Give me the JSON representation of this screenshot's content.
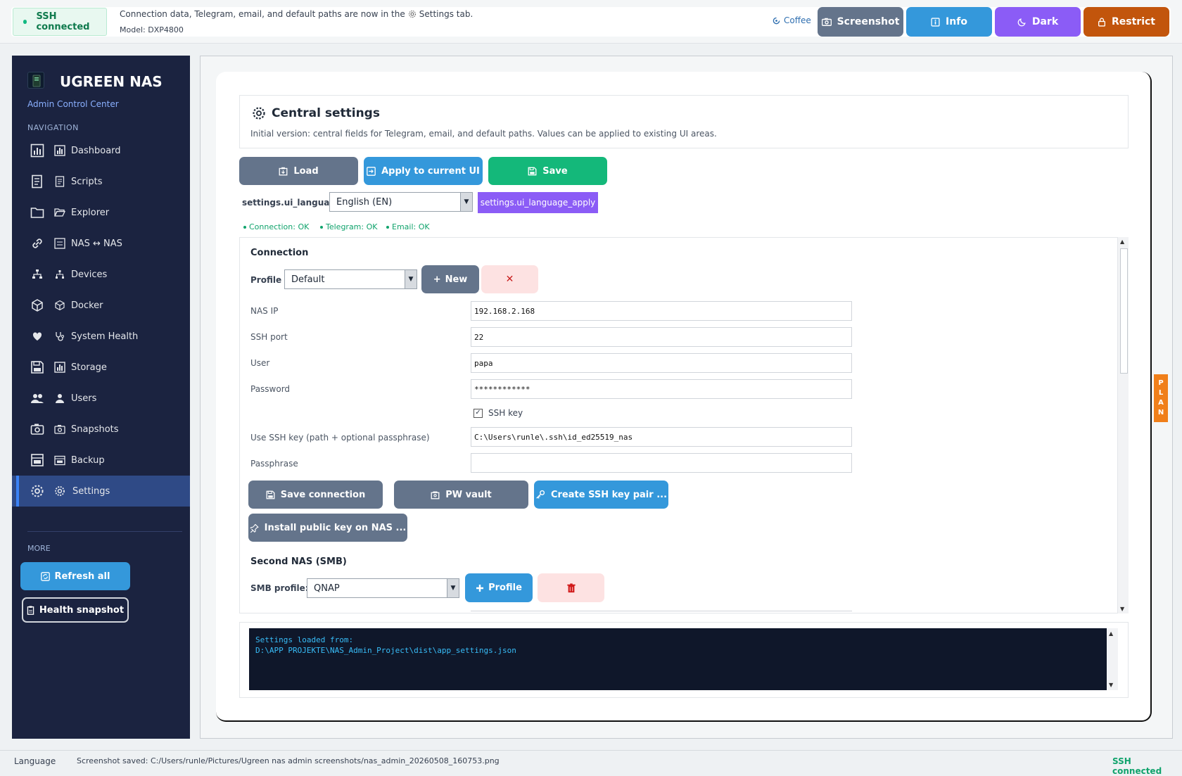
{
  "topbar": {
    "ssh_status": "SSH connected",
    "info_line_prefix": "Connection data, Telegram, email, and default paths are now in the",
    "info_line_suffix": "Settings tab.",
    "model": "Model: DXP4800",
    "coffee": "Coffee",
    "buttons": {
      "screenshot": "Screenshot",
      "info": "Info",
      "dark": "Dark",
      "restrict": "Restrict"
    }
  },
  "sidebar": {
    "title": "UGREEN NAS",
    "subtitle": "Admin Control Center",
    "nav_heading": "NAVIGATION",
    "items": [
      {
        "label": "Dashboard",
        "icon": "bar-chart-icon"
      },
      {
        "label": "Scripts",
        "icon": "script-icon"
      },
      {
        "label": "Explorer",
        "icon": "folder-icon"
      },
      {
        "label": "NAS ↔ NAS",
        "icon": "link-icon"
      },
      {
        "label": "Devices",
        "icon": "network-icon"
      },
      {
        "label": "Docker",
        "icon": "cube-icon"
      },
      {
        "label": "System Health",
        "icon": "heart-icon"
      },
      {
        "label": "Storage",
        "icon": "floppy-icon"
      },
      {
        "label": "Users",
        "icon": "users-icon"
      },
      {
        "label": "Snapshots",
        "icon": "camera-icon"
      },
      {
        "label": "Backup",
        "icon": "backup-icon"
      },
      {
        "label": "Settings",
        "icon": "gear-icon"
      }
    ],
    "active_item": "Settings",
    "more_heading": "MORE",
    "refresh_all": "Refresh all",
    "health_snapshot": "Health snapshot"
  },
  "settings": {
    "title": "Central settings",
    "description": "Initial version: central fields for Telegram, email, and default paths. Values can be applied to existing UI areas.",
    "load": "Load",
    "apply": "Apply to current UI",
    "save": "Save",
    "language_label": "settings.ui_language",
    "language_value": "English (EN)",
    "language_apply": "settings.ui_language_apply",
    "status": {
      "connection": "Connection: OK",
      "telegram": "Telegram: OK",
      "email": "Email: OK"
    },
    "connection": {
      "title": "Connection",
      "profile_label": "Profile",
      "profile_value": "Default",
      "new": "New",
      "nas_ip_label": "NAS IP",
      "nas_ip": "192.168.2.168",
      "ssh_port_label": "SSH port",
      "ssh_port": "22",
      "user_label": "User",
      "user": "papa",
      "password_label": "Password",
      "password": "************",
      "ssh_key_label": "SSH key",
      "ssh_key_checked": true,
      "key_path_label": "Use SSH key (path + optional passphrase)",
      "key_path": "C:\\Users\\runle\\.ssh\\id_ed25519_nas",
      "passphrase_label": "Passphrase",
      "passphrase": "",
      "save_connection": "Save connection",
      "pw_vault": "PW vault",
      "create_key_pair": "Create SSH key pair ...",
      "install_public_key": "Install public key on NAS ..."
    },
    "smb": {
      "title": "Second NAS (SMB)",
      "profile_label": "SMB profile:",
      "profile_value": "QNAP",
      "add_profile": "Profile"
    },
    "log": "Settings loaded from:\nD:\\APP PROJEKTE\\NAS_Admin_Project\\dist\\app_settings.json"
  },
  "plan_tab": [
    "P",
    "L",
    "A",
    "N"
  ],
  "footer": {
    "language": "Language",
    "message": "Screenshot saved: C:/Users/runle/Pictures/Ugreen nas admin screenshots/nas_admin_20260508_160753.png",
    "ssh_status": "SSH connected"
  },
  "colors": {
    "sidebar_bg": "#1b2340",
    "active_nav": "#2f4a86",
    "blue": "#3498db",
    "slate": "#64748b",
    "green": "#14b87a",
    "purple": "#8b5cf6",
    "orange": "#c2550c",
    "status_green": "#10a36c"
  }
}
